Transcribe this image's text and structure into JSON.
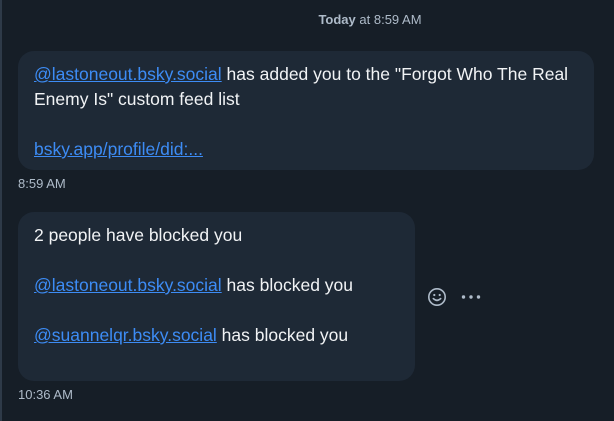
{
  "header": {
    "day": "Today",
    "time_suffix": " at 8:59 AM"
  },
  "messages": [
    {
      "mention": "@lastoneout.bsky.social",
      "text": " has added you to the \"Forgot Who The Real Enemy Is\" custom feed list",
      "link": "bsky.app/profile/did:...",
      "timestamp": "8:59 AM"
    },
    {
      "intro": "2 people have blocked you",
      "lines": [
        {
          "mention": "@lastoneout.bsky.social",
          "text": " has blocked you"
        },
        {
          "mention": "@suannelqr.bsky.social",
          "text": " has blocked you"
        }
      ],
      "timestamp": "10:36 AM"
    }
  ],
  "actions": {
    "emoji_icon": "emoji-smile-icon",
    "more_icon": "more-horizontal-icon"
  },
  "colors": {
    "background": "#161e27",
    "bubble": "#1e2936",
    "link": "#3d8cf5",
    "muted_text": "#aebbc9",
    "text": "#f1f3f5"
  }
}
